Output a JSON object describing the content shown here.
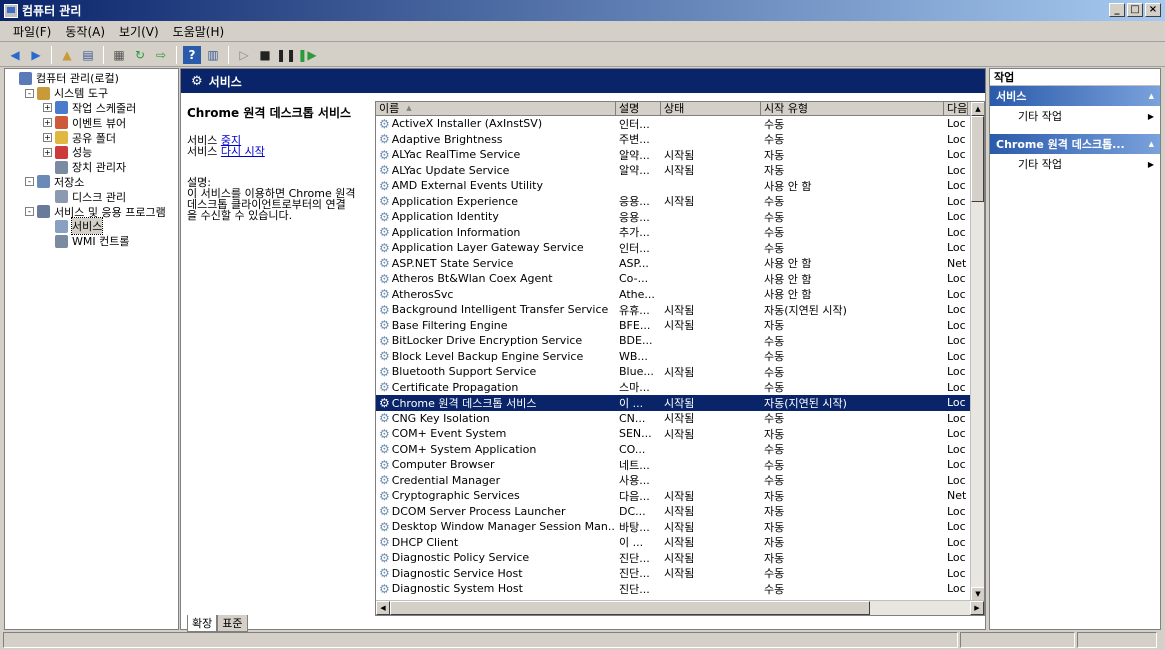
{
  "window": {
    "title": "컴퓨터 관리"
  },
  "window_buttons": {
    "minimize": "_",
    "maximize": "□",
    "close": "×"
  },
  "menu": [
    "파일(F)",
    "동작(A)",
    "보기(V)",
    "도움말(H)"
  ],
  "toolbar_icons": [
    "back-icon",
    "forward-icon",
    "up-folder-icon",
    "show-tree-icon",
    "export-icon",
    "refresh-icon",
    "export-list-icon",
    "help-icon",
    "view-icon",
    "play-icon",
    "stop-icon",
    "pause-icon",
    "restart-icon"
  ],
  "tree": [
    {
      "label": "컴퓨터 관리(로컬)",
      "level": 0,
      "expander": "",
      "icon": "computer-icon",
      "color": "#5a7ab8"
    },
    {
      "label": "시스템 도구",
      "level": 1,
      "expander": "-",
      "icon": "tools-icon",
      "color": "#c89a3a"
    },
    {
      "label": "작업 스케줄러",
      "level": 2,
      "expander": "+",
      "icon": "clock-icon",
      "color": "#4a7acc"
    },
    {
      "label": "이벤트 뷰어",
      "level": 2,
      "expander": "+",
      "icon": "event-viewer-icon",
      "color": "#cc5a3a"
    },
    {
      "label": "공유 폴더",
      "level": 2,
      "expander": "+",
      "icon": "shared-folder-icon",
      "color": "#e0b840"
    },
    {
      "label": "성능",
      "level": 2,
      "expander": "+",
      "icon": "performance-icon",
      "color": "#cc3a3a"
    },
    {
      "label": "장치 관리자",
      "level": 2,
      "expander": "",
      "icon": "device-manager-icon",
      "color": "#7a8aa0"
    },
    {
      "label": "저장소",
      "level": 1,
      "expander": "-",
      "icon": "storage-icon",
      "color": "#6a8ab8"
    },
    {
      "label": "디스크 관리",
      "level": 2,
      "expander": "",
      "icon": "disk-icon",
      "color": "#8a9ab0"
    },
    {
      "label": "서비스 및 응용 프로그램",
      "level": 1,
      "expander": "-",
      "icon": "services-apps-icon",
      "color": "#6a7a9a"
    },
    {
      "label": "서비스",
      "level": 2,
      "expander": "",
      "icon": "gear-icon",
      "color": "#8aa0c0",
      "selected": true
    },
    {
      "label": "WMI 컨트롤",
      "level": 2,
      "expander": "",
      "icon": "wmi-icon",
      "color": "#7a8aa0"
    }
  ],
  "middle": {
    "header": "서비스",
    "service_name": "Chrome 원격 데스크톱 서비스",
    "links": {
      "stop_prefix": "서비스 ",
      "stop": "중지",
      "restart_prefix": "서비스 ",
      "restart": "다시 시작"
    },
    "desc_label": "설명:",
    "desc_lines": [
      "이 서비스를 이용하면 Chrome 원격",
      "데스크톱 클라이언트로부터의 연결",
      "을 수신할 수 있습니다."
    ],
    "tabs": [
      "확장",
      "표준"
    ]
  },
  "columns": [
    "이름",
    "설명",
    "상태",
    "시작 유형",
    "다음"
  ],
  "services": [
    [
      "ActiveX Installer (AxInstSV)",
      "인터...",
      "",
      "수동",
      "Loc"
    ],
    [
      "Adaptive Brightness",
      "주변...",
      "",
      "수동",
      "Loc"
    ],
    [
      "ALYac RealTime Service",
      "알약...",
      "시작됨",
      "자동",
      "Loc"
    ],
    [
      "ALYac Update Service",
      "알약...",
      "시작됨",
      "자동",
      "Loc"
    ],
    [
      "AMD External Events Utility",
      "",
      "",
      "사용 안 함",
      "Loc"
    ],
    [
      "Application Experience",
      "응용...",
      "시작됨",
      "수동",
      "Loc"
    ],
    [
      "Application Identity",
      "응용...",
      "",
      "수동",
      "Loc"
    ],
    [
      "Application Information",
      "추가...",
      "",
      "수동",
      "Loc"
    ],
    [
      "Application Layer Gateway Service",
      "인터...",
      "",
      "수동",
      "Loc"
    ],
    [
      "ASP.NET State Service",
      "ASP...",
      "",
      "사용 안 함",
      "Net"
    ],
    [
      "Atheros Bt&Wlan Coex Agent",
      "Co-...",
      "",
      "사용 안 함",
      "Loc"
    ],
    [
      "AtherosSvc",
      "Athe...",
      "",
      "사용 안 함",
      "Loc"
    ],
    [
      "Background Intelligent Transfer Service",
      "유휴...",
      "시작됨",
      "자동(지연된 시작)",
      "Loc"
    ],
    [
      "Base Filtering Engine",
      "BFE...",
      "시작됨",
      "자동",
      "Loc"
    ],
    [
      "BitLocker Drive Encryption Service",
      "BDE...",
      "",
      "수동",
      "Loc"
    ],
    [
      "Block Level Backup Engine Service",
      "WB...",
      "",
      "수동",
      "Loc"
    ],
    [
      "Bluetooth Support Service",
      "Blue...",
      "시작됨",
      "수동",
      "Loc"
    ],
    [
      "Certificate Propagation",
      "스마...",
      "",
      "수동",
      "Loc"
    ],
    [
      "Chrome 원격 데스크톱 서비스",
      "이 ...",
      "시작됨",
      "자동(지연된 시작)",
      "Loc"
    ],
    [
      "CNG Key Isolation",
      "CN...",
      "시작됨",
      "수동",
      "Loc"
    ],
    [
      "COM+ Event System",
      "SEN...",
      "시작됨",
      "자동",
      "Loc"
    ],
    [
      "COM+ System Application",
      "CO...",
      "",
      "수동",
      "Loc"
    ],
    [
      "Computer Browser",
      "네트...",
      "",
      "수동",
      "Loc"
    ],
    [
      "Credential Manager",
      "사용...",
      "",
      "수동",
      "Loc"
    ],
    [
      "Cryptographic Services",
      "다음...",
      "시작됨",
      "자동",
      "Net"
    ],
    [
      "DCOM Server Process Launcher",
      "DC...",
      "시작됨",
      "자동",
      "Loc"
    ],
    [
      "Desktop Window Manager Session Man...",
      "바탕...",
      "시작됨",
      "자동",
      "Loc"
    ],
    [
      "DHCP Client",
      "이 ...",
      "시작됨",
      "자동",
      "Loc"
    ],
    [
      "Diagnostic Policy Service",
      "진단...",
      "시작됨",
      "자동",
      "Loc"
    ],
    [
      "Diagnostic Service Host",
      "진단...",
      "시작됨",
      "수동",
      "Loc"
    ],
    [
      "Diagnostic System Host",
      "진단...",
      "",
      "수동",
      "Loc"
    ]
  ],
  "selected_service": "Chrome 원격 데스크톱 서비스",
  "actions": {
    "title": "작업",
    "groups": [
      {
        "header": "서비스",
        "item": "기타 작업"
      },
      {
        "header": "Chrome 원격 데스크톱...",
        "item": "기타 작업"
      }
    ]
  },
  "glyphs": {
    "collapse": "▲",
    "submenu": "▶",
    "scroll_up": "▲",
    "scroll_down": "▼",
    "scroll_left": "◀",
    "scroll_right": "▶",
    "sort": "▲",
    "gear": "⚙"
  }
}
